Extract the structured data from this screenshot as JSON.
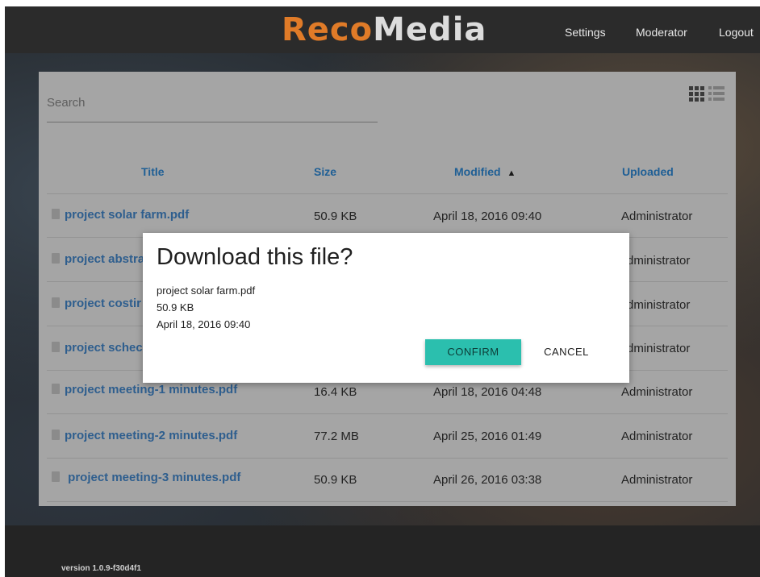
{
  "header": {
    "logo_part1": "Reco",
    "logo_part2": "Media",
    "nav": {
      "settings": "Settings",
      "moderator": "Moderator",
      "logout": "Logout"
    }
  },
  "search": {
    "label": "Search"
  },
  "view_toggle": {
    "grid_icon": "grid-view-icon",
    "list_icon": "list-view-icon"
  },
  "table": {
    "columns": {
      "title": "Title",
      "size": "Size",
      "modified": "Modified",
      "uploaded": "Uploaded"
    },
    "sort": {
      "column": "Modified",
      "direction": "ascending",
      "indicator": "▲"
    },
    "rows": [
      {
        "title": "project solar farm.pdf",
        "size": "50.9 KB",
        "modified": "April 18, 2016 09:40",
        "uploaded": "Administrator"
      },
      {
        "title": "project abstra",
        "size": "",
        "modified": "",
        "uploaded": "dministrator"
      },
      {
        "title": "project costir",
        "size": "",
        "modified": "",
        "uploaded": "dministrator"
      },
      {
        "title": "project schec",
        "size": "",
        "modified": "",
        "uploaded": "dministrator"
      },
      {
        "title": "project meeting-1 minutes.pdf",
        "size": "16.4 KB",
        "modified": "April 18, 2016 04:48",
        "uploaded": "Administrator"
      },
      {
        "title": "project meeting-2 minutes.pdf",
        "size": "77.2 MB",
        "modified": "April 25, 2016 01:49",
        "uploaded": "Administrator"
      },
      {
        "title": "project meeting-3 minutes.pdf",
        "size": "50.9 KB",
        "modified": "April 26, 2016 03:38",
        "uploaded": "Administrator"
      }
    ]
  },
  "dialog": {
    "title": "Download this file?",
    "file_name": "project solar farm.pdf",
    "file_size": "50.9 KB",
    "file_modified": "April 18, 2016 09:40",
    "confirm_label": "CONFIRM",
    "cancel_label": "CANCEL"
  },
  "footer": {
    "version": "version 1.0.9-f30d4f1"
  },
  "colors": {
    "accent": "#2bbfae",
    "logo_orange": "#e07b28",
    "link_blue": "#2e5e8e"
  }
}
